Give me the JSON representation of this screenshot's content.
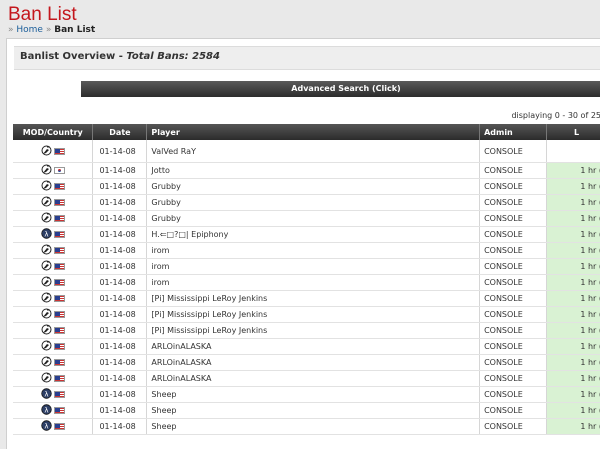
{
  "header": {
    "title": "Ban List",
    "breadcrumb": {
      "separator": "»",
      "home": "Home",
      "current": "Ban List"
    }
  },
  "overview": {
    "title": "Banlist Overview - ",
    "total_label": "Total Bans: 2584"
  },
  "advanced_search": {
    "label": "Advanced Search (Click)"
  },
  "displaying": "displaying 0 - 30 of 25",
  "table": {
    "columns": [
      "MOD/Country",
      "Date",
      "Player",
      "Admin",
      "L"
    ],
    "rows": [
      {
        "mod": "css-icon",
        "country": "us",
        "date": "01-14-08",
        "player": "ValVed RaY",
        "admin": "CONSOLE",
        "length": ""
      },
      {
        "mod": "css-icon",
        "country": "kr",
        "date": "01-14-08",
        "player": "Jotto",
        "admin": "CONSOLE",
        "length": "1 hr ("
      },
      {
        "mod": "css-icon",
        "country": "us",
        "date": "01-14-08",
        "player": "Grubby",
        "admin": "CONSOLE",
        "length": "1 hr ("
      },
      {
        "mod": "css-icon",
        "country": "us",
        "date": "01-14-08",
        "player": "Grubby",
        "admin": "CONSOLE",
        "length": "1 hr ("
      },
      {
        "mod": "css-icon",
        "country": "us",
        "date": "01-14-08",
        "player": "Grubby",
        "admin": "CONSOLE",
        "length": "1 hr ("
      },
      {
        "mod": "hl2dm-icon",
        "country": "us",
        "date": "01-14-08",
        "player": "H.⇐□?□| Epiphony",
        "admin": "CONSOLE",
        "length": "1 hr ("
      },
      {
        "mod": "css-icon",
        "country": "us",
        "date": "01-14-08",
        "player": "irom",
        "admin": "CONSOLE",
        "length": "1 hr ("
      },
      {
        "mod": "css-icon",
        "country": "us",
        "date": "01-14-08",
        "player": "irom",
        "admin": "CONSOLE",
        "length": "1 hr ("
      },
      {
        "mod": "css-icon",
        "country": "us",
        "date": "01-14-08",
        "player": "irom",
        "admin": "CONSOLE",
        "length": "1 hr ("
      },
      {
        "mod": "css-icon",
        "country": "us",
        "date": "01-14-08",
        "player": "[Pi] Mississippi LeRoy Jenkins",
        "admin": "CONSOLE",
        "length": "1 hr ("
      },
      {
        "mod": "css-icon",
        "country": "us",
        "date": "01-14-08",
        "player": "[Pi] Mississippi LeRoy Jenkins",
        "admin": "CONSOLE",
        "length": "1 hr ("
      },
      {
        "mod": "css-icon",
        "country": "us",
        "date": "01-14-08",
        "player": "[Pi] Mississippi LeRoy Jenkins",
        "admin": "CONSOLE",
        "length": "1 hr ("
      },
      {
        "mod": "css-icon",
        "country": "us",
        "date": "01-14-08",
        "player": "ARLOinALASKA",
        "admin": "CONSOLE",
        "length": "1 hr ("
      },
      {
        "mod": "css-icon",
        "country": "us",
        "date": "01-14-08",
        "player": "ARLOinALASKA",
        "admin": "CONSOLE",
        "length": "1 hr ("
      },
      {
        "mod": "css-icon",
        "country": "us",
        "date": "01-14-08",
        "player": "ARLOinALASKA",
        "admin": "CONSOLE",
        "length": "1 hr ("
      },
      {
        "mod": "hl2dm-icon",
        "country": "us",
        "date": "01-14-08",
        "player": "Sheep",
        "admin": "CONSOLE",
        "length": "1 hr ("
      },
      {
        "mod": "hl2dm-icon",
        "country": "us",
        "date": "01-14-08",
        "player": "Sheep",
        "admin": "CONSOLE",
        "length": "1 hr ("
      },
      {
        "mod": "hl2dm-icon",
        "country": "us",
        "date": "01-14-08",
        "player": "Sheep",
        "admin": "CONSOLE",
        "length": "1 hr ("
      }
    ]
  }
}
